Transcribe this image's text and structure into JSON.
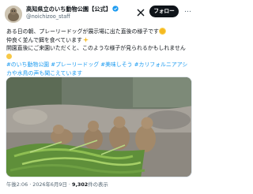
{
  "author": {
    "display_name": "高知県立のいち動物公園【公式】",
    "handle": "@noichizoo_staff",
    "verified_color": "#1d9bf0"
  },
  "actions": {
    "follow_label": "フォロー",
    "more_label": "…",
    "x_logo": "x-logo-icon"
  },
  "tweet": {
    "line1": "ある日の朝、プレーリードッグが展示場に出た直後の様子です",
    "line2": "仲良く並んで餌を食べています",
    "line3": "開園直後にご来園いただくと、このような様子が見られるかもしれません",
    "hashtags_line1": "#のいち動物公園 #プレーリードッグ #美味しそう #カリフォルニアアシ",
    "hashtags_line2": "カや水鳥の声も聞こえています"
  },
  "media": {
    "description_icon": "video-thumbnail"
  },
  "meta": {
    "time": "午後2:06",
    "separator": "·",
    "date": "2026年6月9日",
    "views_count": "9,302",
    "views_label": "件の表示"
  },
  "colors": {
    "accent": "#1d9bf0",
    "text": "#0f1419",
    "secondary": "#536471"
  }
}
